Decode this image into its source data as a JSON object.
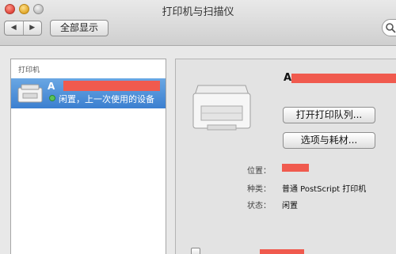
{
  "window": {
    "title": "打印机与扫描仪"
  },
  "toolbar": {
    "back_glyph": "◀",
    "forward_glyph": "▶",
    "show_all_label": "全部显示",
    "search_icon": "magnifier-icon"
  },
  "sidebar": {
    "header": "打印机",
    "items": [
      {
        "name": "A",
        "status": "闲置，上一次使用的设备",
        "status_color": "#5ac25a"
      }
    ]
  },
  "detail": {
    "printer_name": "A",
    "open_queue_label": "打开打印队列...",
    "options_label": "选项与耗材...",
    "location_label": "位置：",
    "kind_label": "种类：",
    "kind_value": "普通 PostScript 打印机",
    "status_label": "状态：",
    "status_value": "闲置"
  },
  "colors": {
    "selection": "#3b7fd0",
    "redaction": "#f05a4e"
  }
}
